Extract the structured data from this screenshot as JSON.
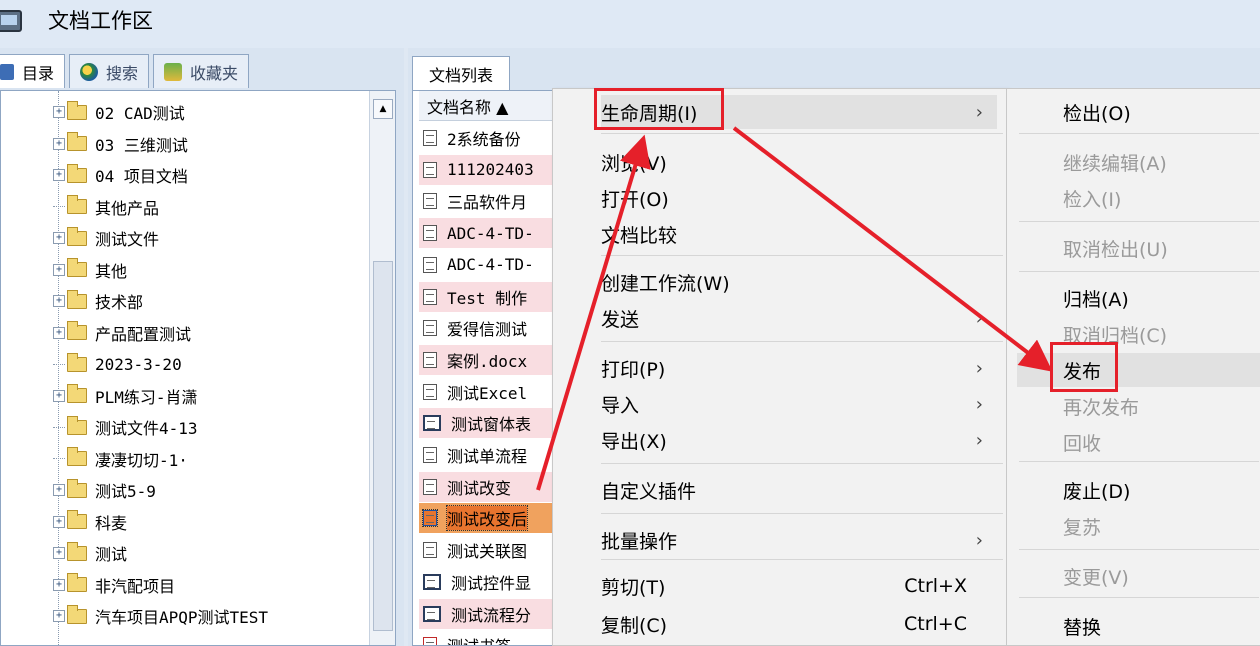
{
  "window": {
    "title": "文档工作区"
  },
  "left_tabs": [
    {
      "label": "目录",
      "icon": "directory-icon"
    },
    {
      "label": "搜索",
      "icon": "search-icon"
    },
    {
      "label": "收藏夹",
      "icon": "favorites-icon"
    }
  ],
  "tree": [
    {
      "label": "02 CAD测试",
      "expandable": true
    },
    {
      "label": "03 三维测试",
      "expandable": true
    },
    {
      "label": "04 项目文档",
      "expandable": true
    },
    {
      "label": "其他产品",
      "expandable": false
    },
    {
      "label": "测试文件",
      "expandable": true
    },
    {
      "label": "其他",
      "expandable": true
    },
    {
      "label": "技术部",
      "expandable": true
    },
    {
      "label": "产品配置测试",
      "expandable": true
    },
    {
      "label": "2023-3-20",
      "expandable": false
    },
    {
      "label": "PLM练习-肖潇",
      "expandable": true
    },
    {
      "label": "测试文件4-13",
      "expandable": false
    },
    {
      "label": "凄凄切切-1·",
      "expandable": false
    },
    {
      "label": "测试5-9",
      "expandable": true
    },
    {
      "label": "科麦",
      "expandable": true
    },
    {
      "label": "测试",
      "expandable": true
    },
    {
      "label": "非汽配项目",
      "expandable": true
    },
    {
      "label": "汽车项目APQP测试TEST",
      "expandable": true
    }
  ],
  "doc_tab": {
    "label": "文档列表"
  },
  "doc_header": {
    "name": "文档名称 ▲"
  },
  "docs": [
    {
      "name": "2系统备份",
      "style": "normal",
      "icon": "document-icon"
    },
    {
      "name": "111202403",
      "style": "pink",
      "icon": "document-icon"
    },
    {
      "name": "三品软件月",
      "style": "normal",
      "icon": "document-icon"
    },
    {
      "name": "ADC-4-TD-",
      "style": "pink",
      "icon": "document-icon"
    },
    {
      "name": "ADC-4-TD-",
      "style": "normal",
      "icon": "document-icon"
    },
    {
      "name": "Test 制作",
      "style": "pink",
      "icon": "document-icon"
    },
    {
      "name": "爱得信测试",
      "style": "normal",
      "icon": "document-icon"
    },
    {
      "name": "案例.docx",
      "style": "pink",
      "icon": "document-icon"
    },
    {
      "name": "测试Excel",
      "style": "normal",
      "icon": "document-icon"
    },
    {
      "name": "测试窗体表",
      "style": "pink",
      "icon": "form-icon"
    },
    {
      "name": "测试单流程",
      "style": "normal",
      "icon": "document-icon"
    },
    {
      "name": "测试改变",
      "style": "pink",
      "icon": "document-icon"
    },
    {
      "name": "测试改变后",
      "style": "selected",
      "icon": "table-icon"
    },
    {
      "name": "测试关联图",
      "style": "normal",
      "icon": "document-icon"
    },
    {
      "name": "测试控件显",
      "style": "normal",
      "icon": "form-icon"
    },
    {
      "name": "测试流程分",
      "style": "pink",
      "icon": "form-icon"
    },
    {
      "name": "测试书签",
      "style": "normal",
      "icon": "pdf-icon"
    }
  ],
  "context_menu": [
    {
      "label": "生命周期(I)",
      "submenu": true,
      "y": 0
    },
    {
      "label": "浏览(V)",
      "y": 1
    },
    {
      "label": "打开(O)",
      "y": 2
    },
    {
      "label": "文档比较",
      "y": 3
    },
    {
      "label": "创建工作流(W)",
      "y": 4
    },
    {
      "label": "发送",
      "submenu": true,
      "y": 5
    },
    {
      "label": "打印(P)",
      "submenu": true,
      "y": 6
    },
    {
      "label": "导入",
      "submenu": true,
      "y": 7
    },
    {
      "label": "导出(X)",
      "submenu": true,
      "y": 8
    },
    {
      "label": "自定义插件",
      "y": 9
    },
    {
      "label": "批量操作",
      "submenu": true,
      "y": 10
    },
    {
      "label": "剪切(T)",
      "shortcut": "Ctrl+X",
      "y": 11
    },
    {
      "label": "复制(C)",
      "shortcut": "Ctrl+C",
      "y": 12
    }
  ],
  "lifecycle_submenu": [
    {
      "label": "检出(O)",
      "enabled": true
    },
    {
      "label": "继续编辑(A)",
      "enabled": false
    },
    {
      "label": "检入(I)",
      "enabled": false
    },
    {
      "label": "取消检出(U)",
      "enabled": false
    },
    {
      "label": "归档(A)",
      "enabled": true
    },
    {
      "label": "取消归档(C)",
      "enabled": false
    },
    {
      "label": "发布",
      "enabled": true
    },
    {
      "label": "再次发布",
      "enabled": false
    },
    {
      "label": "回收",
      "enabled": false
    },
    {
      "label": "废止(D)",
      "enabled": true
    },
    {
      "label": "复苏",
      "enabled": false
    },
    {
      "label": "变更(V)",
      "enabled": false
    },
    {
      "label": "替换",
      "enabled": true
    }
  ],
  "colors": {
    "annotation": "#e5202a",
    "selected_row": "#e8742e",
    "pink_row": "#f9dde1"
  }
}
